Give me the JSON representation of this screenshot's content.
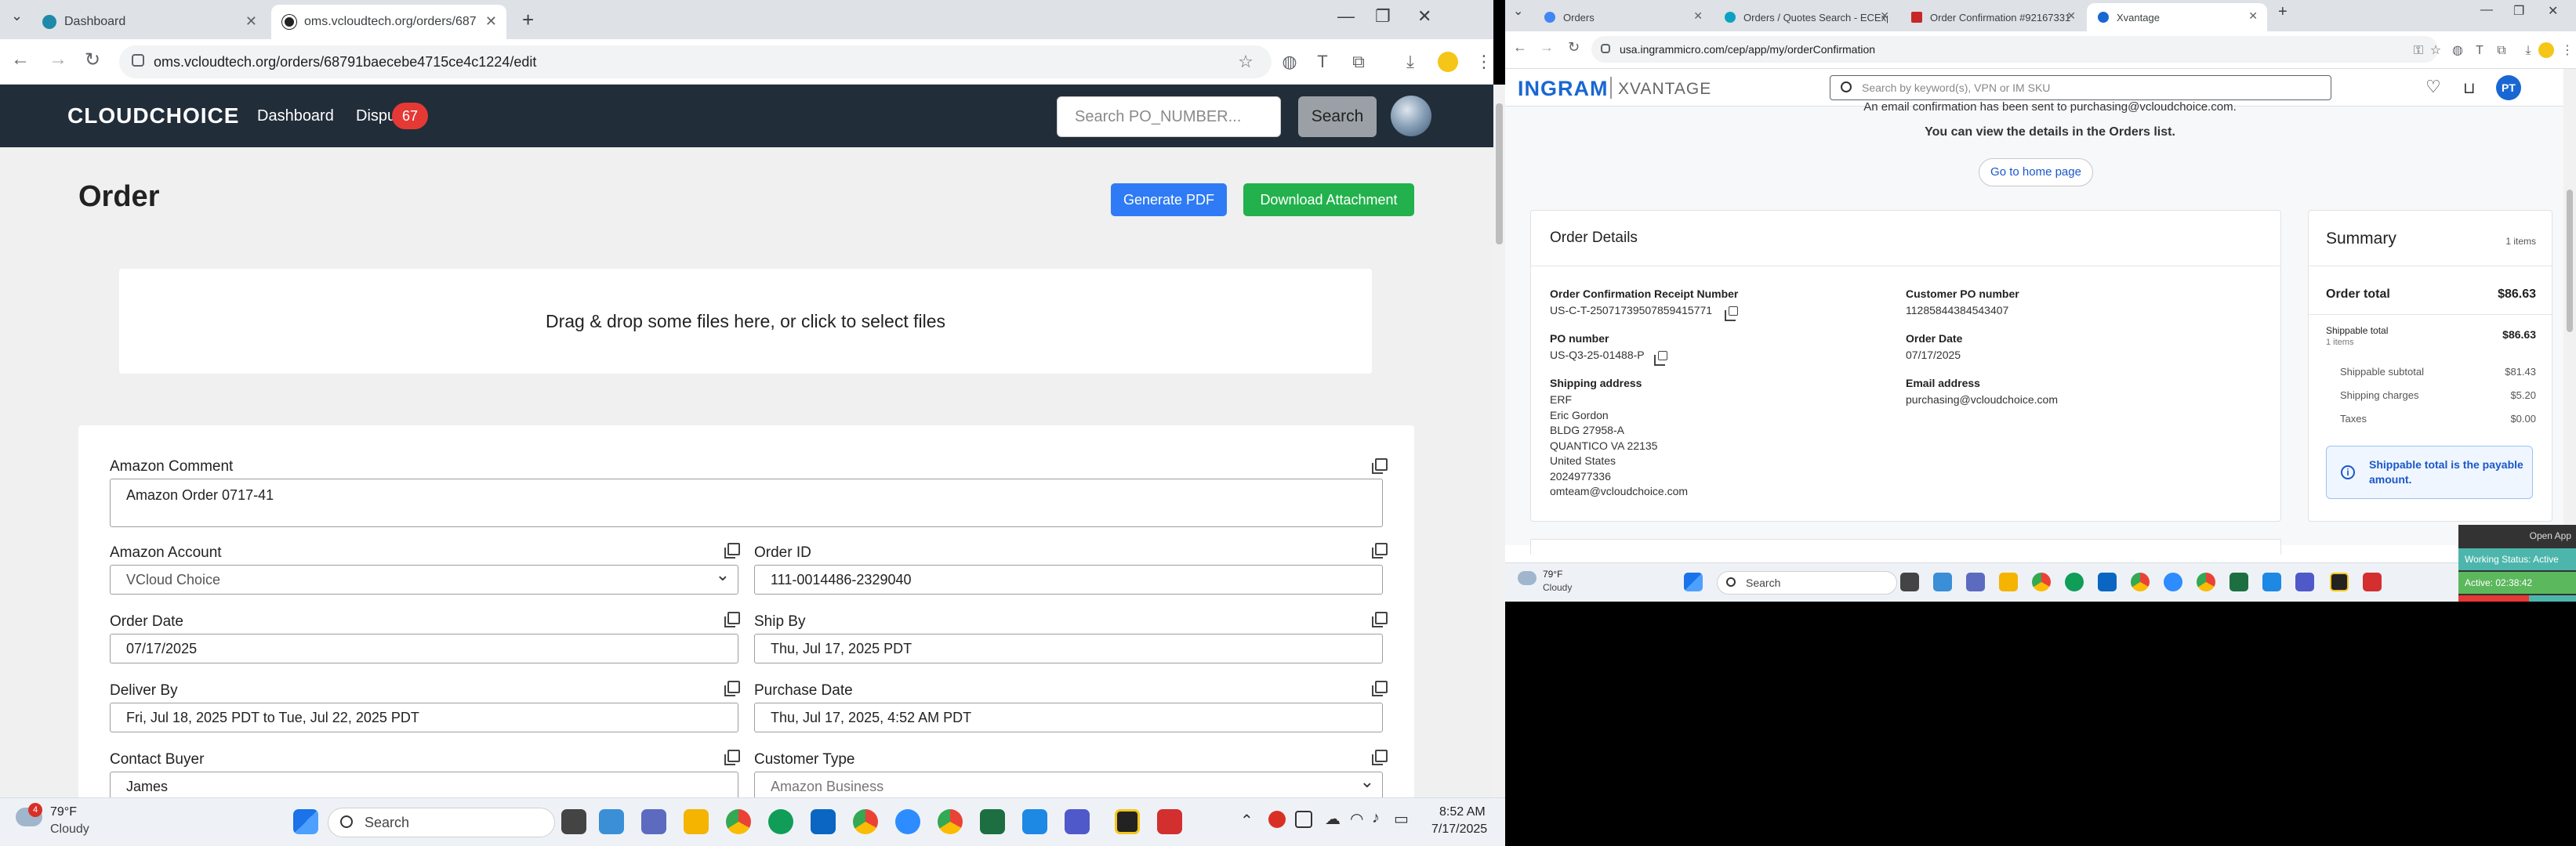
{
  "left_browser": {
    "tabs": [
      {
        "label": "Dashboard",
        "active": false
      },
      {
        "label": "oms.vcloudtech.org/orders/687",
        "active": true
      }
    ],
    "url": "oms.vcloudtech.org/orders/68791baecebe4715ce4c1224/edit"
  },
  "cc_nav": {
    "logo": "CLOUDCHOICE",
    "links": [
      "Dashboard",
      "Dispu"
    ],
    "dispute_badge": "67",
    "search_placeholder": "Search PO_NUMBER...",
    "search_button": "Search"
  },
  "order_page": {
    "title": "Order",
    "generate_pdf": "Generate PDF",
    "download_attachment": "Download Attachment",
    "dropzone_text": "Drag & drop some files here, or click to select files",
    "fields": {
      "amazon_comment": {
        "label": "Amazon Comment",
        "value": "Amazon Order 0717-41"
      },
      "amazon_account": {
        "label": "Amazon Account",
        "value": "VCloud Choice"
      },
      "order_id": {
        "label": "Order ID",
        "value": "111-0014486-2329040"
      },
      "order_date": {
        "label": "Order Date",
        "value": "07/17/2025"
      },
      "ship_by": {
        "label": "Ship By",
        "value": "Thu, Jul 17, 2025 PDT"
      },
      "deliver_by": {
        "label": "Deliver By",
        "value": "Fri, Jul 18, 2025 PDT to Tue, Jul 22, 2025 PDT"
      },
      "purchase_date": {
        "label": "Purchase Date",
        "value": "Thu, Jul 17, 2025, 4:52 AM PDT"
      },
      "contact_buyer": {
        "label": "Contact Buyer",
        "value": "James"
      },
      "customer_type": {
        "label": "Customer Type",
        "value": "Amazon Business"
      }
    }
  },
  "left_taskbar": {
    "weather_temp": "79°F",
    "weather_cond": "Cloudy",
    "weather_badge": "4",
    "search_label": "Search",
    "time": "8:52 AM",
    "date": "7/17/2025"
  },
  "right_browser": {
    "tabs": [
      {
        "label": "Orders",
        "active": false
      },
      {
        "label": "Orders / Quotes Search - ECExp",
        "active": false
      },
      {
        "label": "Order Confirmation #92167331",
        "active": false
      },
      {
        "label": "Xvantage",
        "active": true
      }
    ],
    "url": "usa.ingrammicro.com/cep/app/my/orderConfirmation"
  },
  "ingram": {
    "logo": "INGRAM",
    "sub_logo": "XVANTAGE",
    "search_placeholder": "Search by keyword(s), VPN or IM SKU",
    "avatar_initials": "PT",
    "notice_top": "An email confirmation has been sent to purchasing@vcloudchoice.com.",
    "notice_line": "You can view the details in the Orders list.",
    "home_button": "Go to home page",
    "order_details": {
      "title": "Order Details",
      "receipt_label": "Order Confirmation Receipt Number",
      "receipt_value": "US-C-T-25071739507859415771",
      "customer_po_label": "Customer PO number",
      "customer_po_value": "11285844384543407",
      "po_label": "PO number",
      "po_value": "US-Q3-25-01488-P",
      "order_date_label": "Order Date",
      "order_date_value": "07/17/2025",
      "shipping_label": "Shipping address",
      "shipping_lines": [
        "ERF",
        "Eric Gordon",
        "BLDG 27958-A",
        "QUANTICO VA 22135",
        "United States",
        "2024977336",
        "omteam@vcloudchoice.com"
      ],
      "email_label": "Email address",
      "email_value": "purchasing@vcloudchoice.com"
    },
    "summary": {
      "title": "Summary",
      "items_count": "1 items",
      "order_total_label": "Order total",
      "order_total_value": "$86.63",
      "shippable_total_label": "Shippable total",
      "shippable_items": "1 items",
      "shippable_total_value": "$86.63",
      "shippable_subtotal_label": "Shippable subtotal",
      "shippable_subtotal_value": "$81.43",
      "shipping_charges_label": "Shipping charges",
      "shipping_charges_value": "$5.20",
      "taxes_label": "Taxes",
      "taxes_value": "$0.00",
      "info_text": "Shippable total is the payable amount."
    }
  },
  "right_taskbar": {
    "weather_temp": "79°F",
    "weather_cond": "Cloudy",
    "search_label": "Search"
  },
  "overlay": {
    "open_app": "Open App",
    "working_status": "Working Status: Active",
    "active_timer": "Active: 02:38:42"
  },
  "colors": {
    "cc_nav_bg": "#222d3a",
    "pdf_blue": "#2f7bf5",
    "download_green": "#22b14c",
    "badge_red": "#e53935",
    "ingram_blue": "#1967d2"
  }
}
